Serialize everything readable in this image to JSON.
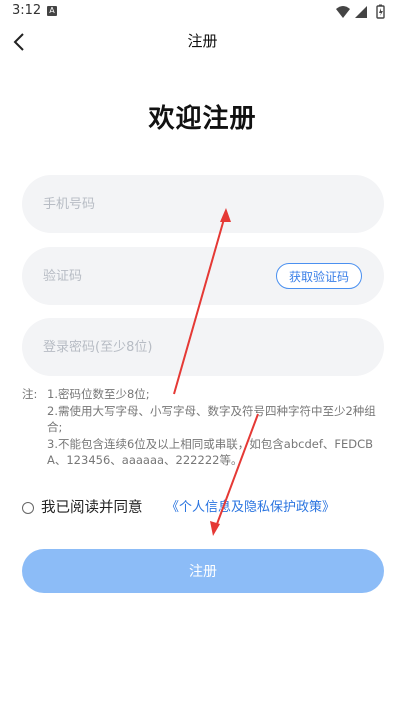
{
  "status_bar": {
    "time": "3:12",
    "app_badge": "A",
    "icons": [
      "wifi-icon",
      "signal-icon",
      "battery-charging-icon"
    ]
  },
  "header": {
    "title": "注册",
    "back_icon": "chevron-left-icon"
  },
  "heading": "欢迎注册",
  "form": {
    "phone_placeholder": "手机号码",
    "phone_value": "",
    "code_placeholder": "验证码",
    "code_value": "",
    "get_code_label": "获取验证码",
    "password_placeholder": "登录密码(至少8位)",
    "password_value": ""
  },
  "note": {
    "label": "注:",
    "lines": [
      "1.密码位数至少8位;",
      "2.需使用大写字母、小写字母、数字及符号四种字符中至少2种组合;",
      "3.不能包含连续6位及以上相同或串联，如包含abcdef、FEDCBA、123456、aaaaaa、222222等。"
    ]
  },
  "agreement": {
    "checked": false,
    "text": "我已阅读并同意",
    "link_text": "《个人信息及隐私保护政策》"
  },
  "submit": {
    "label": "注册"
  },
  "colors": {
    "accent": "#3a7fe8",
    "button_disabled": "#8cbcf7",
    "field_bg": "#f3f4f6",
    "annotation_arrow": "#e53935"
  }
}
